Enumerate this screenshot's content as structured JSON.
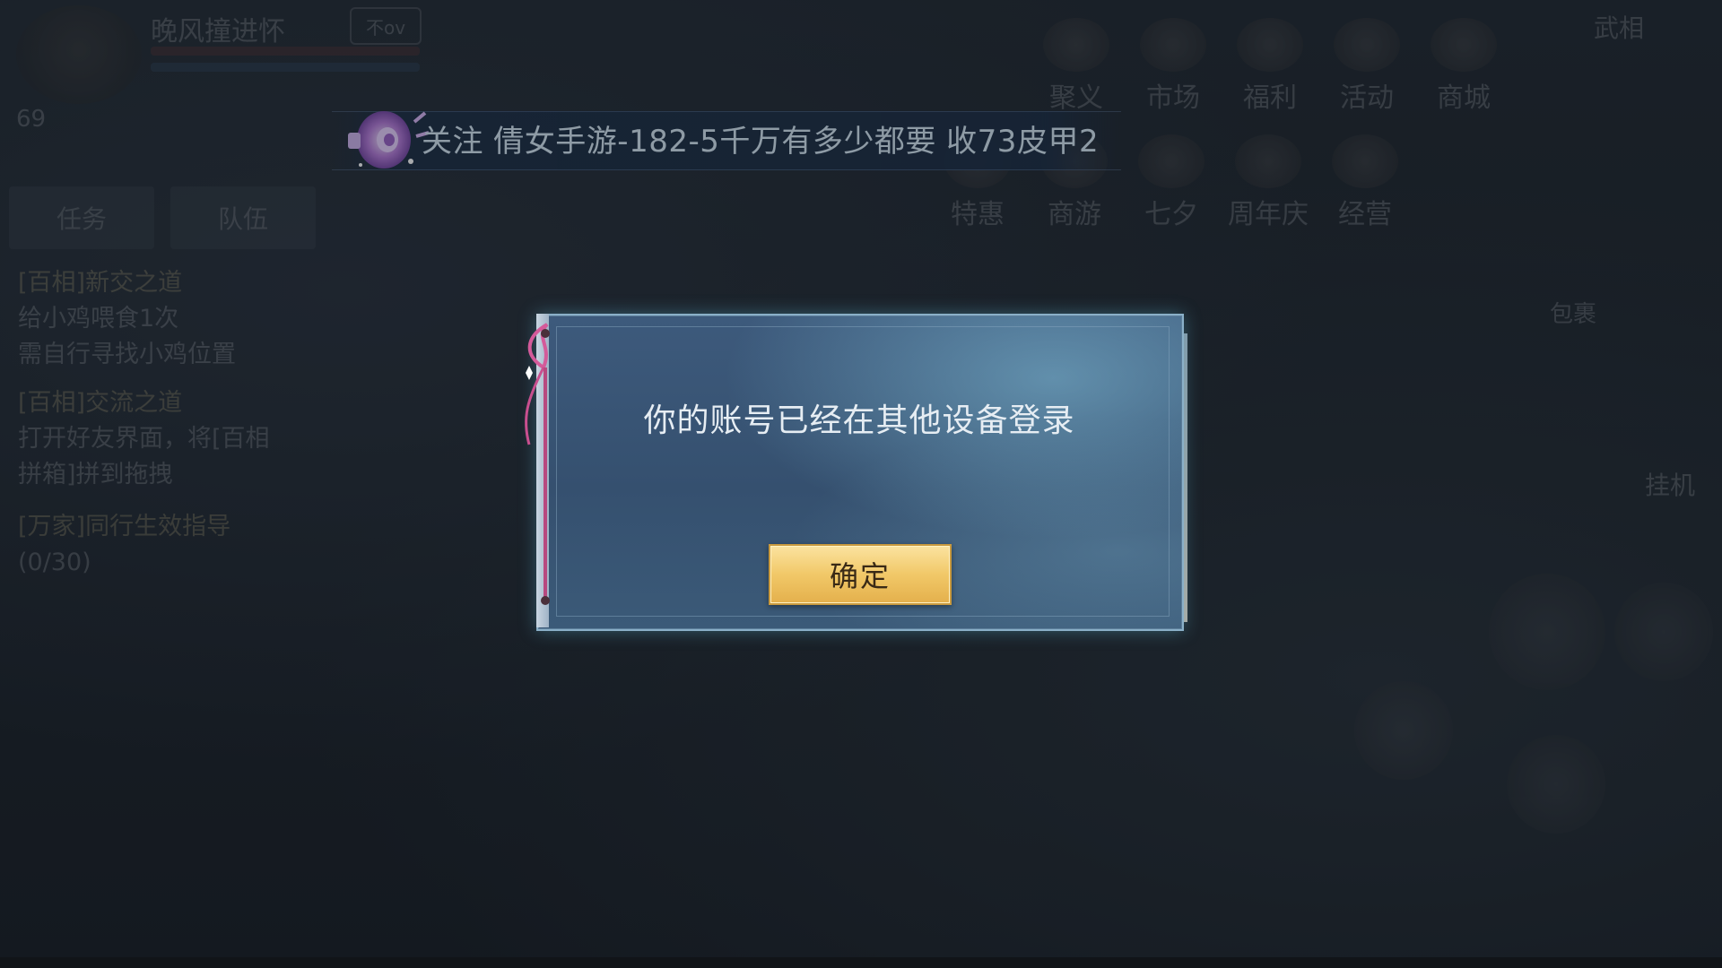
{
  "background_hud": {
    "player_level": "69",
    "player_name": "晚风撞进怀",
    "badge_label": "不ov",
    "tabs": [
      "任务",
      "队伍"
    ],
    "quests": [
      {
        "title": "[百相]新交之道",
        "desc": "给小鸡喂食1次",
        "extra": "需自行寻找小鸡位置"
      },
      {
        "title": "[百相]交流之道",
        "desc": "打开好友界面，将[百相",
        "extra": "拼箱]拼到拖拽"
      },
      {
        "title": "[万家]同行生效指导",
        "desc": "(0/30)",
        "extra": ""
      }
    ],
    "top_icons_row1": [
      "聚义",
      "市场",
      "福利",
      "活动",
      "商城"
    ],
    "top_icons_row2": [
      "特惠",
      "商游",
      "七夕",
      "周年庆",
      "经营"
    ],
    "corner_label": "武相",
    "bag_label": "包裹",
    "afk_label": "挂机"
  },
  "broadcast": {
    "text": "关注 倩女手游-182-5千万有多少都要   收73皮甲2"
  },
  "dialog": {
    "message": "你的账号已经在其他设备登录",
    "confirm_label": "确定"
  },
  "colors": {
    "confirm_button": "#f1c868",
    "dialog_panel": "#3d5a7c",
    "broadcast_text": "#d6e6f3"
  }
}
